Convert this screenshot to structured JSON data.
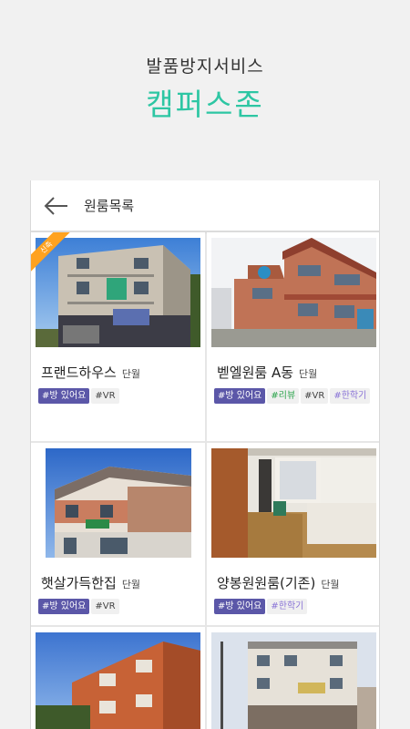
{
  "promo": {
    "subtitle": "발품방지서비스",
    "title": "캠퍼스존"
  },
  "appbar": {
    "back_icon": "arrow-left-icon",
    "title": "원룸목록"
  },
  "colors": {
    "accent": "#2dc6a3",
    "room_tag": "#5b57a8",
    "new_badge": "#ffa21f"
  },
  "listings": [
    {
      "name": "프랜드하우스",
      "type": "단월",
      "badge": "신축",
      "tags": [
        {
          "text": "#방 있어요",
          "style": "room"
        },
        {
          "text": "#VR",
          "style": "plain"
        }
      ]
    },
    {
      "name": "벧엘원룸 A동",
      "type": "단월",
      "tags": [
        {
          "text": "#방 있어요",
          "style": "room"
        },
        {
          "text": "#리뷰",
          "style": "green"
        },
        {
          "text": "#VR",
          "style": "plain"
        },
        {
          "text": "#한학기",
          "style": "purple"
        }
      ]
    },
    {
      "name": "햇살가득한집",
      "type": "단월",
      "tags": [
        {
          "text": "#방 있어요",
          "style": "room"
        },
        {
          "text": "#VR",
          "style": "plain"
        }
      ]
    },
    {
      "name": "양봉원원룸(기존)",
      "type": "단월",
      "tags": [
        {
          "text": "#방 있어요",
          "style": "room"
        },
        {
          "text": "#한학기",
          "style": "purple"
        }
      ]
    },
    {
      "name": "",
      "type": "",
      "tags": []
    },
    {
      "name": "",
      "type": "",
      "tags": []
    }
  ]
}
